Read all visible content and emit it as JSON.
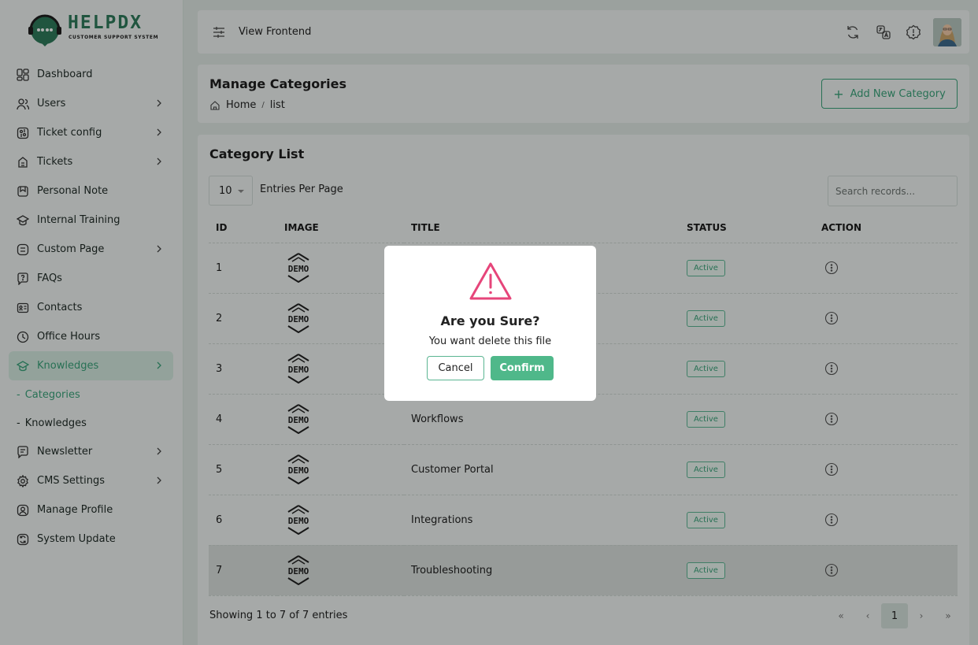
{
  "brand": {
    "name": "HELPDX",
    "tagline": "CUSTOMER SUPPORT SYSTEM",
    "accent": "#3aa27a"
  },
  "sidebar": {
    "items": [
      {
        "label": "Dashboard",
        "icon": "dashboard-icon",
        "has_children": false
      },
      {
        "label": "Users",
        "icon": "users-icon",
        "has_children": true
      },
      {
        "label": "Ticket config",
        "icon": "ticket-config-icon",
        "has_children": true
      },
      {
        "label": "Tickets",
        "icon": "tickets-icon",
        "has_children": true
      },
      {
        "label": "Personal Note",
        "icon": "note-icon",
        "has_children": false
      },
      {
        "label": "Internal Training",
        "icon": "training-icon",
        "has_children": false
      },
      {
        "label": "Custom Page",
        "icon": "page-icon",
        "has_children": true
      },
      {
        "label": "FAQs",
        "icon": "faq-icon",
        "has_children": false
      },
      {
        "label": "Contacts",
        "icon": "contacts-icon",
        "has_children": false
      },
      {
        "label": "Office Hours",
        "icon": "clock-icon",
        "has_children": false
      },
      {
        "label": "Knowledges",
        "icon": "knowledge-icon",
        "has_children": true,
        "active": true
      }
    ],
    "sub_items": [
      {
        "label": "Categories",
        "active": true
      },
      {
        "label": "Knowledges",
        "active": false
      }
    ],
    "items_after": [
      {
        "label": "Newsletter",
        "icon": "newsletter-icon",
        "has_children": true
      },
      {
        "label": "CMS Settings",
        "icon": "settings-icon",
        "has_children": true
      },
      {
        "label": "Manage Profile",
        "icon": "profile-icon",
        "has_children": false
      },
      {
        "label": "System Update",
        "icon": "update-icon",
        "has_children": false
      }
    ]
  },
  "topbar": {
    "view_frontend": "View Frontend"
  },
  "header": {
    "title": "Manage Categories",
    "breadcrumb_home": "Home",
    "breadcrumb_sep": "/",
    "breadcrumb_current": "list",
    "add_button": "Add New Category"
  },
  "category_list": {
    "title": "Category List",
    "per_page_value": "10",
    "per_page_label": "Entries Per Page",
    "search_placeholder": "Search records...",
    "columns": [
      "ID",
      "IMAGE",
      "TITLE",
      "STATUS",
      "ACTION"
    ],
    "rows": [
      {
        "id": "1",
        "title": "",
        "status": "Active"
      },
      {
        "id": "2",
        "title": "",
        "status": "Active"
      },
      {
        "id": "3",
        "title": "",
        "status": "Active"
      },
      {
        "id": "4",
        "title": "Workflows",
        "status": "Active"
      },
      {
        "id": "5",
        "title": "Customer Portal",
        "status": "Active"
      },
      {
        "id": "6",
        "title": "Integrations",
        "status": "Active"
      },
      {
        "id": "7",
        "title": "Troubleshooting",
        "status": "Active"
      }
    ],
    "image_text": "DEMO",
    "showing": "Showing 1 to 7 of 7 entries",
    "pagination": {
      "first": "«",
      "prev": "‹",
      "current": "1",
      "next": "›",
      "last": "»"
    }
  },
  "modal": {
    "title": "Are you Sure?",
    "message": "You want delete this file",
    "cancel": "Cancel",
    "confirm": "Confirm",
    "warning_color": "#e6457a"
  }
}
